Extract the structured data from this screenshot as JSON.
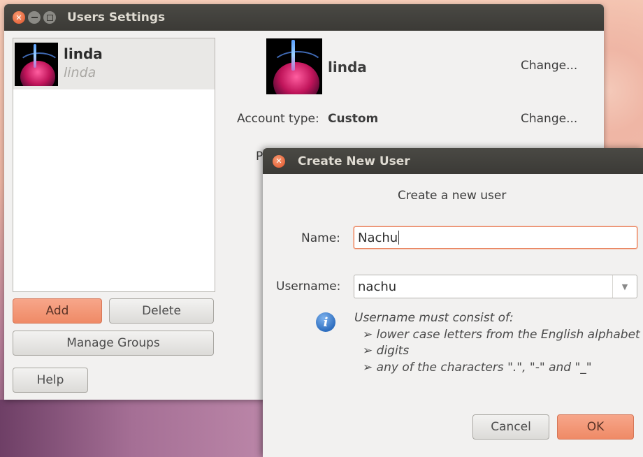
{
  "main_window": {
    "title": "Users Settings",
    "user_list": [
      {
        "name": "linda",
        "username": "linda"
      }
    ],
    "buttons": {
      "add": "Add",
      "delete": "Delete",
      "manage_groups": "Manage Groups",
      "help": "Help"
    },
    "detail": {
      "name": "linda",
      "change_1": "Change...",
      "account_type_label": "Account type:",
      "account_type_value": "Custom",
      "change_2": "Change...",
      "partial_label": "P"
    }
  },
  "dialog": {
    "title": "Create New User",
    "heading": "Create a new user",
    "name_label": "Name:",
    "name_value": "Nachu",
    "username_label": "Username:",
    "username_value": "nachu",
    "hint": {
      "intro": "Username must consist of:",
      "items": [
        "lower case letters from the English alphabet",
        "digits",
        "any of the characters \".\", \"-\" and \"_\""
      ]
    },
    "cancel": "Cancel",
    "ok": "OK"
  },
  "colors": {
    "accent": "#ef8a66",
    "titlebar": "#3c3b37",
    "window_bg": "#f2f1f0"
  }
}
